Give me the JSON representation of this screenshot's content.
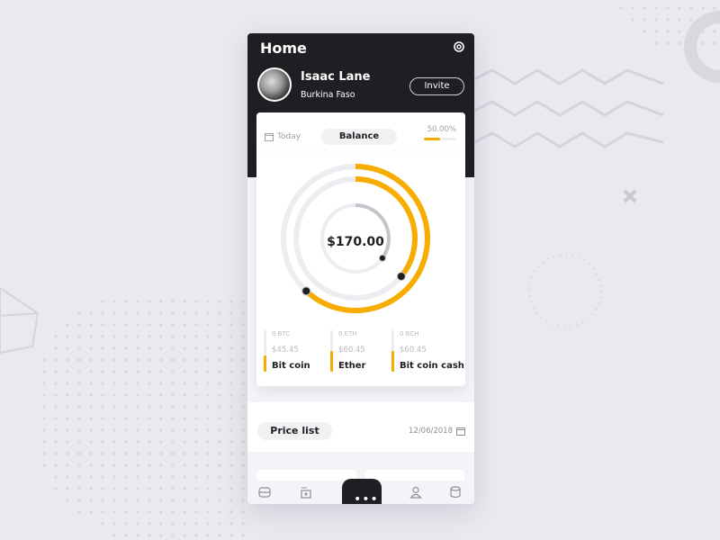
{
  "header": {
    "title": "Home",
    "settings_icon": "gear-icon"
  },
  "user": {
    "name": "Isaac Lane",
    "country": "Burkina Faso",
    "invite_label": "Invite"
  },
  "tabs": {
    "today_label": "Today",
    "balance_label": "Balance",
    "progress_text": "50.00%",
    "progress_value": 0.5
  },
  "balance": {
    "total": "$170.00",
    "rings": [
      {
        "name": "outer",
        "fraction": 0.62,
        "color": "#f7ad00"
      },
      {
        "name": "middle",
        "fraction": 0.36,
        "color": "#f7ad00"
      },
      {
        "name": "inner",
        "fraction": 0.35,
        "color": "#c4c4cc"
      }
    ]
  },
  "coins": [
    {
      "amount": "0 BTC",
      "usd": "$45.45",
      "name": "Bit coin",
      "level": 0.4
    },
    {
      "amount": "0 ETH",
      "usd": "$60.45",
      "name": "Ether",
      "level": 0.5
    },
    {
      "amount": "0 BCH",
      "usd": "$60.45",
      "name": "Bit coin cash",
      "level": 0.5
    }
  ],
  "price_list": {
    "label": "Price list",
    "date": "12/06/2018"
  },
  "nav": {
    "items": [
      "wallet-icon",
      "cards-icon",
      "more-icon",
      "profile-icon",
      "database-icon"
    ]
  },
  "colors": {
    "accent": "#f7ad00",
    "dark": "#1f1f23"
  }
}
